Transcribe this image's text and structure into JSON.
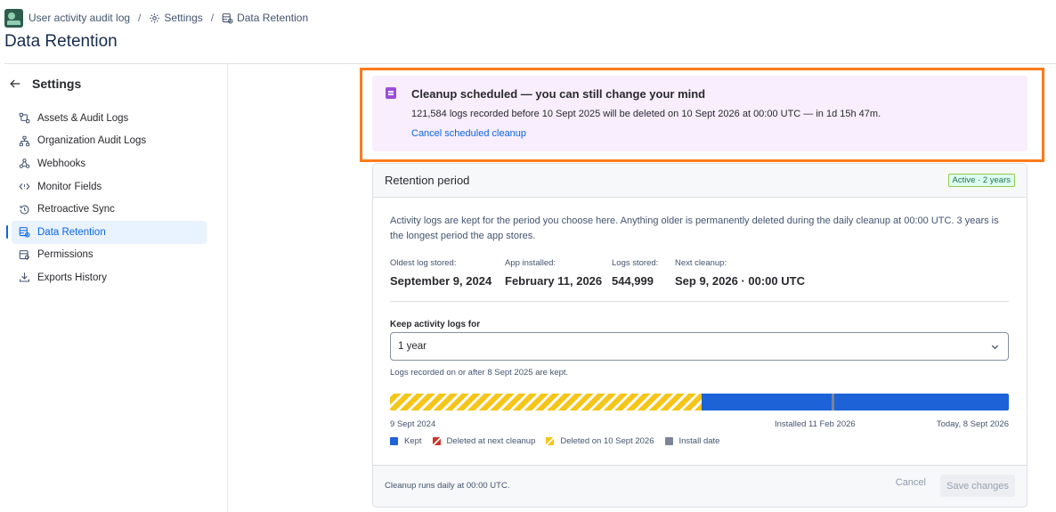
{
  "breadcrumb": {
    "app": "User activity audit log",
    "separator": "/",
    "settings": "Settings",
    "current": "Data Retention"
  },
  "page_title": "Data Retention",
  "sidebar": {
    "back_label": "Settings",
    "items": [
      {
        "label": "Assets & Audit Logs",
        "icon": "assets-icon"
      },
      {
        "label": "Organization Audit Logs",
        "icon": "org-tree-icon"
      },
      {
        "label": "Webhooks",
        "icon": "webhook-icon"
      },
      {
        "label": "Monitor Fields",
        "icon": "code-icon"
      },
      {
        "label": "Retroactive Sync",
        "icon": "history-icon"
      },
      {
        "label": "Data Retention",
        "icon": "data-retention-icon",
        "active": true
      },
      {
        "label": "Permissions",
        "icon": "permissions-icon"
      },
      {
        "label": "Exports History",
        "icon": "download-icon"
      }
    ]
  },
  "banner": {
    "title": "Cleanup scheduled — you can still change your mind",
    "text": "121,584 logs recorded before 10 Sept 2025 will be deleted on 10 Sept 2026 at 00:00 UTC — in 1d 15h 47m.",
    "link": "Cancel scheduled cleanup",
    "accent": "#9c4ed6",
    "background": "#f8eefe"
  },
  "card": {
    "title": "Retention period",
    "badge": "Active · 2 years",
    "description": "Activity logs are kept for the period you choose here. Anything older is permanently deleted during the daily cleanup at 00:00 UTC. 3 years is the longest period the app stores.",
    "stats": [
      {
        "label": "Oldest log stored:",
        "value": "September 9, 2024"
      },
      {
        "label": "App installed:",
        "value": "February 11, 2026"
      },
      {
        "label": "Logs stored:",
        "value": "544,999"
      },
      {
        "label": "Next cleanup:",
        "value": "Sep 9, 2026 · 00:00 UTC"
      }
    ],
    "keep_label": "Keep activity logs for",
    "select_value": "1 year",
    "helper": "Logs recorded on or after 8 Sept 2025 are kept.",
    "timeline": {
      "start_label": "9 Sept 2024",
      "install_label": "Installed 11 Feb 2026",
      "end_label": "Today, 8 Sept 2026",
      "deleted_fraction": 0.504,
      "install_fraction": 0.714,
      "kept_color": "#1d62d6",
      "deleted_color": "#f5c518"
    },
    "legend": {
      "kept": "Kept",
      "next": "Deleted at next cleanup",
      "sept": "Deleted on 10 Sept 2026",
      "install": "Install date"
    },
    "footer_note": "Cleanup runs daily at 00:00 UTC.",
    "cancel": "Cancel",
    "save": "Save changes"
  }
}
